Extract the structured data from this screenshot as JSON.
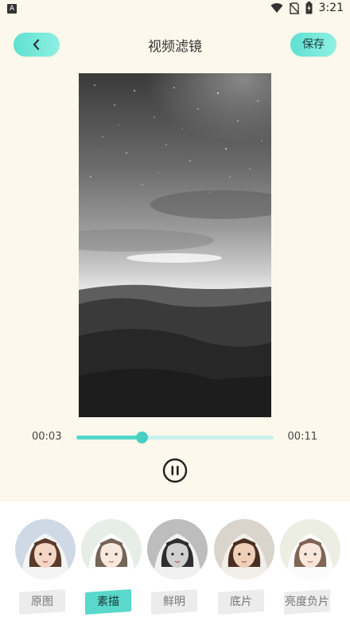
{
  "status_bar": {
    "app_icon": "A",
    "time": "3:21",
    "icons": [
      "wifi-icon",
      "no-sim-icon",
      "battery-icon"
    ]
  },
  "header": {
    "back_icon": "chevron-left-icon",
    "title": "视频滤镜",
    "save_label": "保存"
  },
  "player": {
    "current_time": "00:03",
    "total_time": "00:11",
    "progress": 0.33,
    "pause_icon": "pause-icon"
  },
  "filters": {
    "selected": "素描",
    "items": [
      {
        "label": "原图",
        "style": "original"
      },
      {
        "label": "素描",
        "style": "sketch"
      },
      {
        "label": "鲜明",
        "style": "gray"
      },
      {
        "label": "底片",
        "style": "film"
      },
      {
        "label": "亮度负片",
        "style": "bright"
      }
    ]
  },
  "colors": {
    "accent": "#55d8ca",
    "background": "#fdf8ec"
  }
}
